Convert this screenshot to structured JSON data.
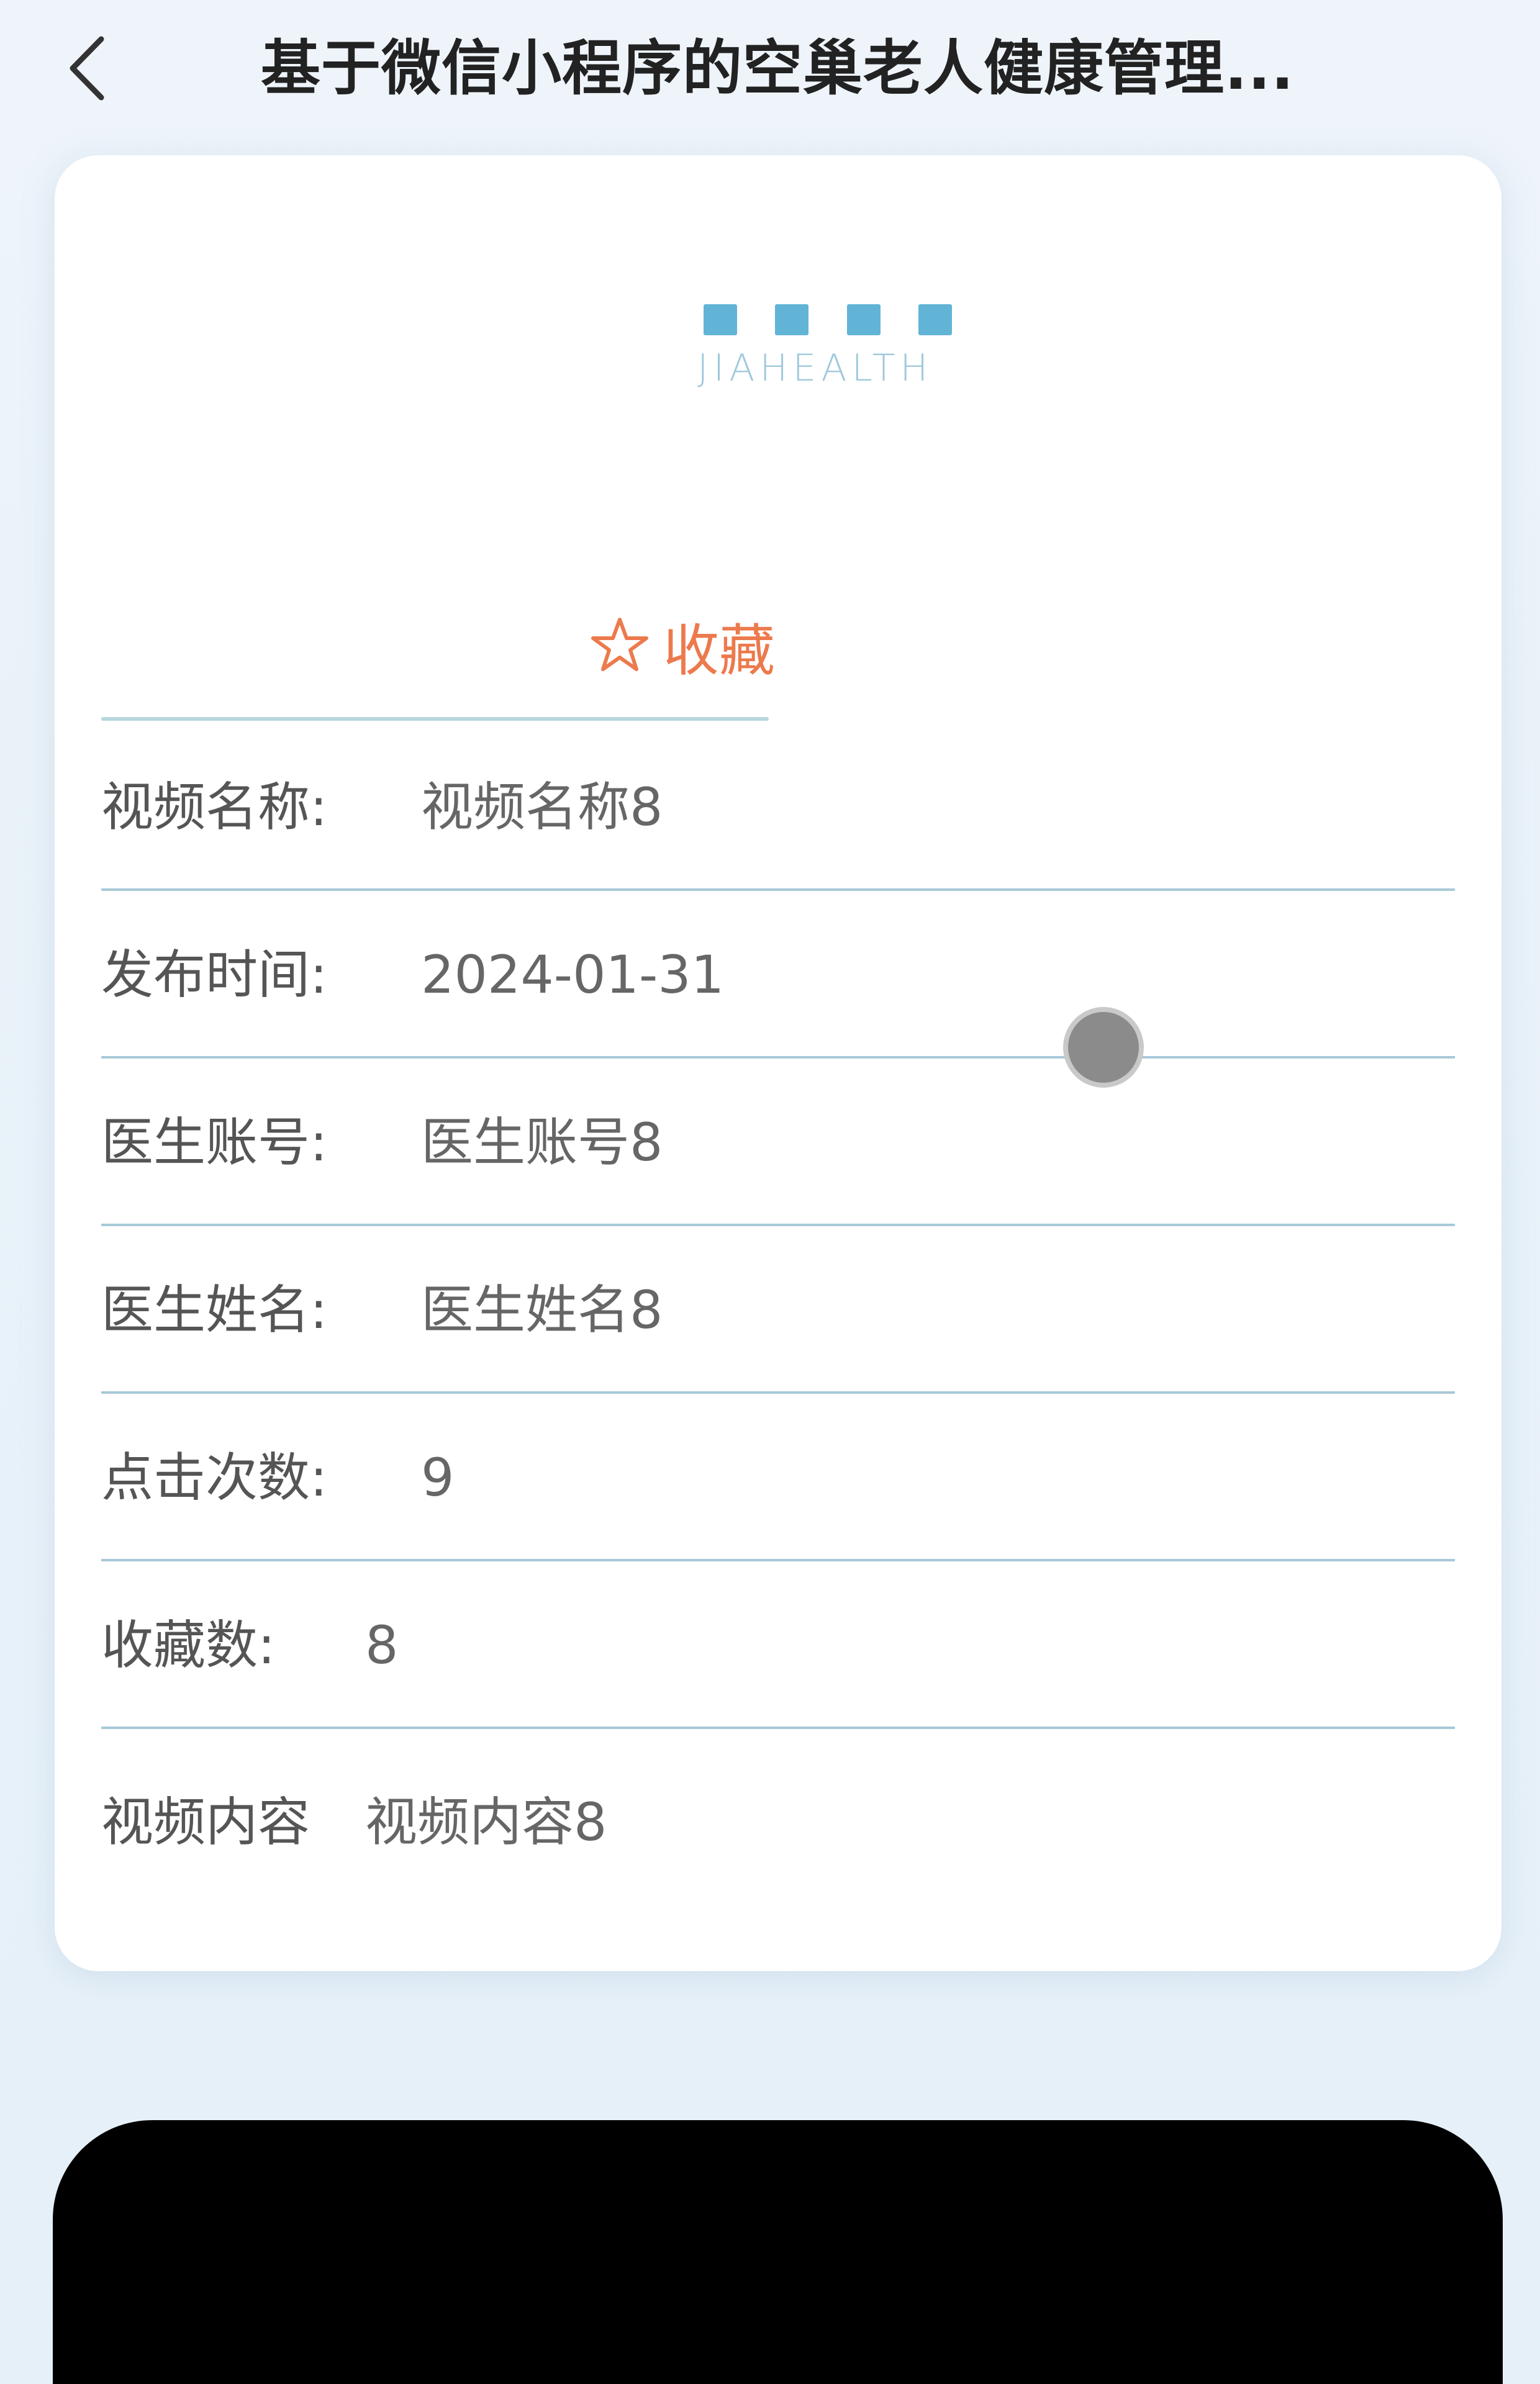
{
  "nav": {
    "title": "基于微信小程序的空巢老人健康管理..."
  },
  "banner": {
    "logo_en": "JIAHEALTH"
  },
  "favorite": {
    "label": "收藏",
    "color": "#ec7a4d"
  },
  "details": [
    {
      "label": "视频名称:",
      "value": "视频名称8"
    },
    {
      "label": "发布时间:",
      "value": "2024-01-31"
    },
    {
      "label": "医生账号:",
      "value": "医生账号8"
    },
    {
      "label": "医生姓名:",
      "value": "医生姓名8"
    },
    {
      "label": "点击次数:",
      "value": "9"
    },
    {
      "label": "收藏数:",
      "value": "8"
    },
    {
      "label": "视频内容",
      "value": "视频内容8"
    }
  ]
}
